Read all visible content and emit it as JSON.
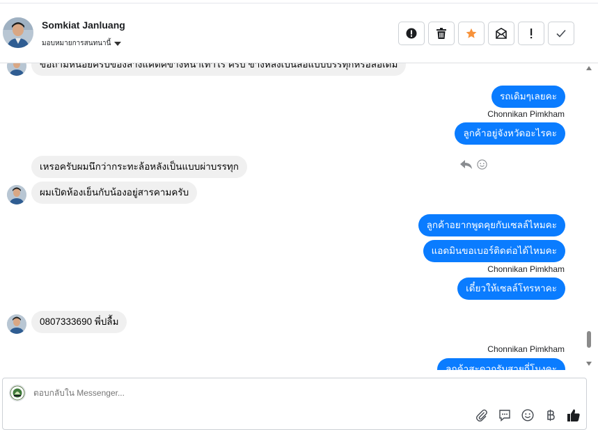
{
  "header": {
    "contact_name": "Somkiat Janluang",
    "assign_label": "มอบหมายการสนทนานี้",
    "actions": [
      {
        "name": "spam-button",
        "icon": "alert-circle-icon"
      },
      {
        "name": "delete-button",
        "icon": "trash-icon"
      },
      {
        "name": "star-button",
        "icon": "star-icon"
      },
      {
        "name": "mark-unread-button",
        "icon": "envelope-icon"
      },
      {
        "name": "important-button",
        "icon": "exclamation-icon"
      },
      {
        "name": "done-button",
        "icon": "checkmark-icon"
      }
    ]
  },
  "messages": [
    {
      "id": "m1",
      "direction": "in",
      "text": "ข้อถามหน่อยครับของล้างแคตค์ข้างหน้าเท่าไร ครับ ข้างหลังเป็นล้อแบบบรรทุกหรือล้อเดิม"
    },
    {
      "id": "m2",
      "direction": "out",
      "text": "รถเดิมๆเลยคะ"
    },
    {
      "id": "m3",
      "direction": "out",
      "sender": "Chonnikan Pimkham",
      "text": "ลูกค้าอยู่จังหวัดอะไรคะ"
    },
    {
      "id": "m4",
      "direction": "in",
      "text": "เหรอครับผมนึกว่ากระทะล้อหลังเป็นแบบผ่าบรรทุก"
    },
    {
      "id": "m5",
      "direction": "in",
      "text": "ผมเปิดห้องเย็นกับน้องอยู่สารคามครับ"
    },
    {
      "id": "m6",
      "direction": "out",
      "text": "ลูกค้าอยากพูดคุยกับเซลล์ไหมคะ"
    },
    {
      "id": "m7",
      "direction": "out",
      "text": "แอดมินขอเบอร์ติดต่อได้ไหมคะ"
    },
    {
      "id": "m8",
      "direction": "out",
      "sender": "Chonnikan Pimkham",
      "text": "เดี๋ยวให้เซลล์โทรหาคะ"
    },
    {
      "id": "m9",
      "direction": "in",
      "text": "0807333690 พี่ปลื้ม"
    },
    {
      "id": "m10",
      "direction": "out",
      "sender": "Chonnikan Pimkham",
      "text": "ลูกค้าสะดวกรับสายกี่โมงคะ"
    }
  ],
  "composer": {
    "placeholder": "ตอบกลับใน Messenger...",
    "tools": [
      "paperclip-icon",
      "saved-reply-icon",
      "emoji-icon",
      "baht-icon",
      "thumbs-up-icon"
    ]
  },
  "colors": {
    "outgoing_bubble": "#0a7cff",
    "incoming_bubble": "#f0f0f0",
    "star": "#f7923a"
  }
}
